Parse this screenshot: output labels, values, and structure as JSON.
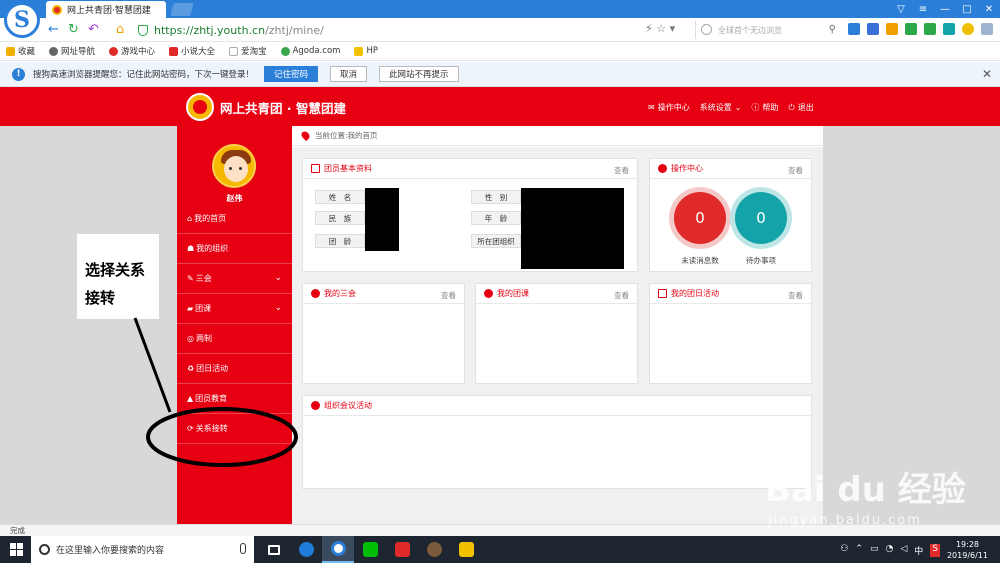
{
  "browser": {
    "tab_title": "网上共青团·智慧团建",
    "url_host": "https://zhtj.youth.cn",
    "url_path": "/zhtj/mine/",
    "search_placeholder": "全球首个无边浏览",
    "window_controls": [
      "—",
      "□",
      "✕"
    ]
  },
  "bookmarks": [
    {
      "label": "收藏",
      "color": "#f0b000"
    },
    {
      "label": "网址导航",
      "color": "#666666"
    },
    {
      "label": "游戏中心",
      "color": "#e02a2a"
    },
    {
      "label": "小说大全",
      "color": "#e02a2a"
    },
    {
      "label": "爱淘宝",
      "color": "#cccccc"
    },
    {
      "label": "Agoda.com",
      "color": "#3aa64a"
    },
    {
      "label": "HP",
      "color": "#f2c200"
    }
  ],
  "infobar": {
    "message": "搜狗高速浏览器提醒您：记住此网站密码，下次一键登录！",
    "remember": "记住密码",
    "cancel": "取消",
    "never": "此网站不再提示"
  },
  "site": {
    "title": "网上共青团 · 智慧团建",
    "nav": [
      "操作中心",
      "系统设置",
      "帮助",
      "退出"
    ]
  },
  "sidebar": {
    "username": "赵伟",
    "items": [
      {
        "label": "我的首页",
        "icon": "home-icon",
        "glyph": "⌂",
        "chevron": false
      },
      {
        "label": "我的组织",
        "icon": "group-icon",
        "glyph": "☗",
        "chevron": false
      },
      {
        "label": "三会",
        "icon": "edit-icon",
        "glyph": "✎",
        "chevron": true
      },
      {
        "label": "团课",
        "icon": "folder-icon",
        "glyph": "▰",
        "chevron": true
      },
      {
        "label": "两制",
        "icon": "target-icon",
        "glyph": "◎",
        "chevron": false
      },
      {
        "label": "团日活动",
        "icon": "recycle-icon",
        "glyph": "♻",
        "chevron": false
      },
      {
        "label": "团员教育",
        "icon": "graduation-icon",
        "glyph": "▲",
        "chevron": false
      },
      {
        "label": "关系接转",
        "icon": "refresh-icon",
        "glyph": "⟳",
        "chevron": false
      }
    ]
  },
  "breadcrumb": "当前位置:我的首页",
  "panels": {
    "profile": {
      "title": "团员基本资料",
      "more": "查看",
      "labels_left": [
        "姓　名",
        "民　族",
        "团　龄"
      ],
      "labels_right": [
        "性　别",
        "年　龄",
        "所在团组织"
      ]
    },
    "ops": {
      "title": "操作中心",
      "more": "查看",
      "unread_count": "0",
      "unread_label": "未读消息数",
      "todo_count": "0",
      "todo_label": "待办事项"
    },
    "sanhui": {
      "title": "我的三会",
      "more": "查看"
    },
    "tuanke": {
      "title": "我的团课",
      "more": "查看"
    },
    "tuanri": {
      "title": "我的团日活动",
      "more": "查看"
    },
    "meeting": {
      "title": "组织会议活动"
    }
  },
  "annotation": {
    "line1": "选择关系",
    "line2": "接转"
  },
  "statusbar": {
    "text": "完成"
  },
  "taskbar": {
    "search_placeholder": "在这里输入你要搜索的内容",
    "time": "19:28",
    "date": "2019/6/11",
    "ime": "中"
  },
  "watermark": {
    "main": "Bai du 经验",
    "sub": "jingyan.baidu.com"
  },
  "colors": {
    "brand_red": "#e60012",
    "browser_blue": "#2b7fd8",
    "unread_circle": "#e02a2a",
    "todo_circle": "#14a3a8"
  }
}
